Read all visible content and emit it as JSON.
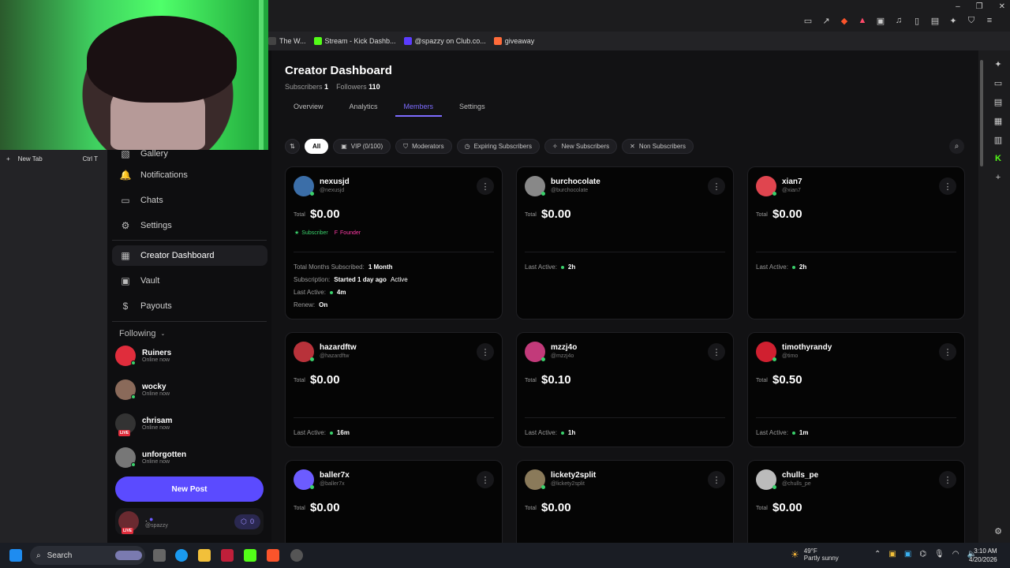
{
  "bookmarks": [
    {
      "label": "The W...",
      "color": "#444"
    },
    {
      "label": "Stream - Kick Dashb...",
      "color": "#53fc18"
    },
    {
      "label": "@spazzy on Club.co...",
      "color": "#5b3cff"
    },
    {
      "label": "giveaway",
      "color": "#ff6b3a"
    }
  ],
  "browser": {
    "new_tab_label": "New Tab",
    "new_tab_shortcut": "Ctrl T"
  },
  "sidebar": {
    "items": [
      {
        "label": "Gallery",
        "icon": "gallery-icon"
      },
      {
        "label": "Notifications",
        "icon": "bell-icon"
      },
      {
        "label": "Chats",
        "icon": "chat-icon"
      },
      {
        "label": "Settings",
        "icon": "gear-icon"
      },
      {
        "label": "Creator Dashboard",
        "icon": "dashboard-icon"
      },
      {
        "label": "Vault",
        "icon": "vault-icon"
      },
      {
        "label": "Payouts",
        "icon": "dollar-icon"
      }
    ],
    "following_label": "Following",
    "following": [
      {
        "name": "Ruiners",
        "status": "Online now",
        "color": "#e02d3c",
        "live": false
      },
      {
        "name": "wocky",
        "status": "Online now",
        "color": "#8a6a5a",
        "live": false
      },
      {
        "name": "chrisam",
        "status": "Online now",
        "color": "#333",
        "live": true
      },
      {
        "name": "unforgotten",
        "status": "Online now",
        "color": "#777",
        "live": false
      }
    ],
    "new_post_label": "New Post",
    "profile": {
      "name": ".",
      "handle": "@spazzy",
      "coins": "0"
    }
  },
  "main": {
    "title": "Creator Dashboard",
    "subscribers_label": "Subscribers",
    "subscribers": "1",
    "followers_label": "Followers",
    "followers": "110",
    "tabs": [
      "Overview",
      "Analytics",
      "Members",
      "Settings"
    ],
    "active_tab": "Members",
    "filters": [
      "All",
      "VIP (0/100)",
      "Moderators",
      "Expiring Subscribers",
      "New Subscribers",
      "Non Subscribers"
    ],
    "total_label": "Total",
    "last_active_label": "Last Active:",
    "members": [
      {
        "name": "nexusjd",
        "handle": "@nexusjd",
        "total": "$0.00",
        "color": "#3b6ea8",
        "badges": {
          "subscriber": "Subscriber",
          "founder": "Founder"
        },
        "months_label": "Total Months Subscribed:",
        "months": "1 Month",
        "subscription_label": "Subscription:",
        "subscription": "Started 1 day ago",
        "subscription_status": "Active",
        "last_active": "4m",
        "renew_label": "Renew:",
        "renew": "On"
      },
      {
        "name": "burchocolate",
        "handle": "@burchocolate",
        "total": "$0.00",
        "color": "#888",
        "last_active": "2h"
      },
      {
        "name": "xian7",
        "handle": "@xian7",
        "total": "$0.00",
        "color": "#e0454f",
        "last_active": "2h"
      },
      {
        "name": "hazardftw",
        "handle": "@hazardftw",
        "total": "$0.00",
        "color": "#b8323a",
        "last_active": "16m"
      },
      {
        "name": "mzzj4o",
        "handle": "@mzzj4o",
        "total": "$0.10",
        "color": "#c23a7a",
        "last_active": "1h"
      },
      {
        "name": "timothyrandy",
        "handle": "@timo",
        "total": "$0.50",
        "color": "#d02030",
        "last_active": "1m"
      },
      {
        "name": "baller7x",
        "handle": "@baller7x",
        "total": "$0.00",
        "color": "#6c5cff"
      },
      {
        "name": "lickety2split",
        "handle": "@lickety2split",
        "total": "$0.00",
        "color": "#8a7a5a"
      },
      {
        "name": "chulls_pe",
        "handle": "@chulls_pe",
        "total": "$0.00",
        "color": "#bbb"
      }
    ]
  },
  "taskbar": {
    "search_label": "Search",
    "weather_temp": "49°F",
    "weather_desc": "Partly sunny",
    "time": "3:10 AM",
    "date": "4/20/2026"
  }
}
